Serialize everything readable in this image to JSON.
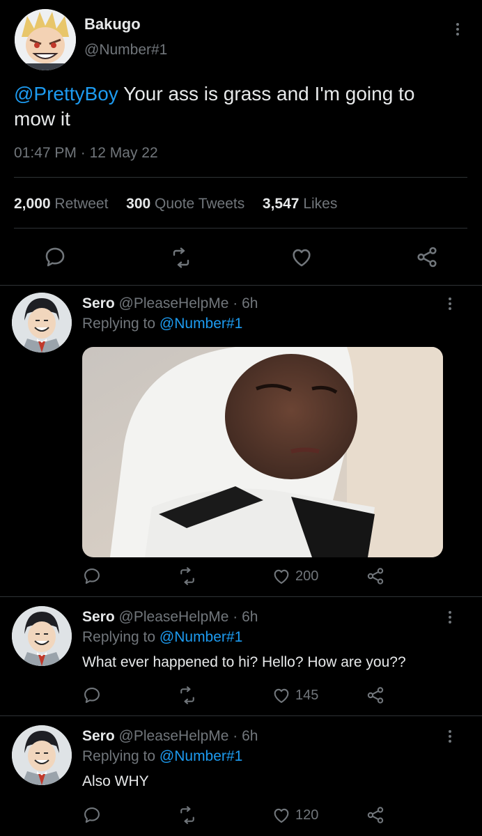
{
  "main_tweet": {
    "display_name": "Bakugo",
    "handle": "@Number#1",
    "mention": "@PrettyBoy",
    "text": " Your ass is grass and I'm going to mow it",
    "time": "01:47 PM",
    "date": "12 May 22",
    "separator": "·",
    "stats": {
      "retweets_count": "2,000",
      "retweets_label": "Retweet",
      "quotes_count": "300",
      "quotes_label": "Quote Tweets",
      "likes_count": "3,547",
      "likes_label": "Likes"
    }
  },
  "replies": [
    {
      "display_name": "Sero",
      "handle": "@PleaseHelpMe",
      "time_sep": " · ",
      "age": "6h",
      "replying_prefix": "Replying to ",
      "replying_to": "@Number#1",
      "text": "",
      "has_media": true,
      "likes": "200"
    },
    {
      "display_name": "Sero",
      "handle": "@PleaseHelpMe",
      "time_sep": " · ",
      "age": "6h",
      "replying_prefix": "Replying to ",
      "replying_to": "@Number#1",
      "text": "What ever happened to hi? Hello? How are you??",
      "has_media": false,
      "likes": "145"
    },
    {
      "display_name": "Sero",
      "handle": "@PleaseHelpMe",
      "time_sep": " · ",
      "age": "6h",
      "replying_prefix": "Replying to ",
      "replying_to": "@Number#1",
      "text": "Also WHY",
      "has_media": false,
      "likes": "120"
    }
  ],
  "colors": {
    "background": "#000000",
    "text": "#e7e9ea",
    "muted": "#71767b",
    "link": "#1d9bf0",
    "divider": "#2f3336"
  },
  "icons": [
    "more-vertical-icon",
    "reply-icon",
    "retweet-icon",
    "like-icon",
    "share-icon"
  ]
}
